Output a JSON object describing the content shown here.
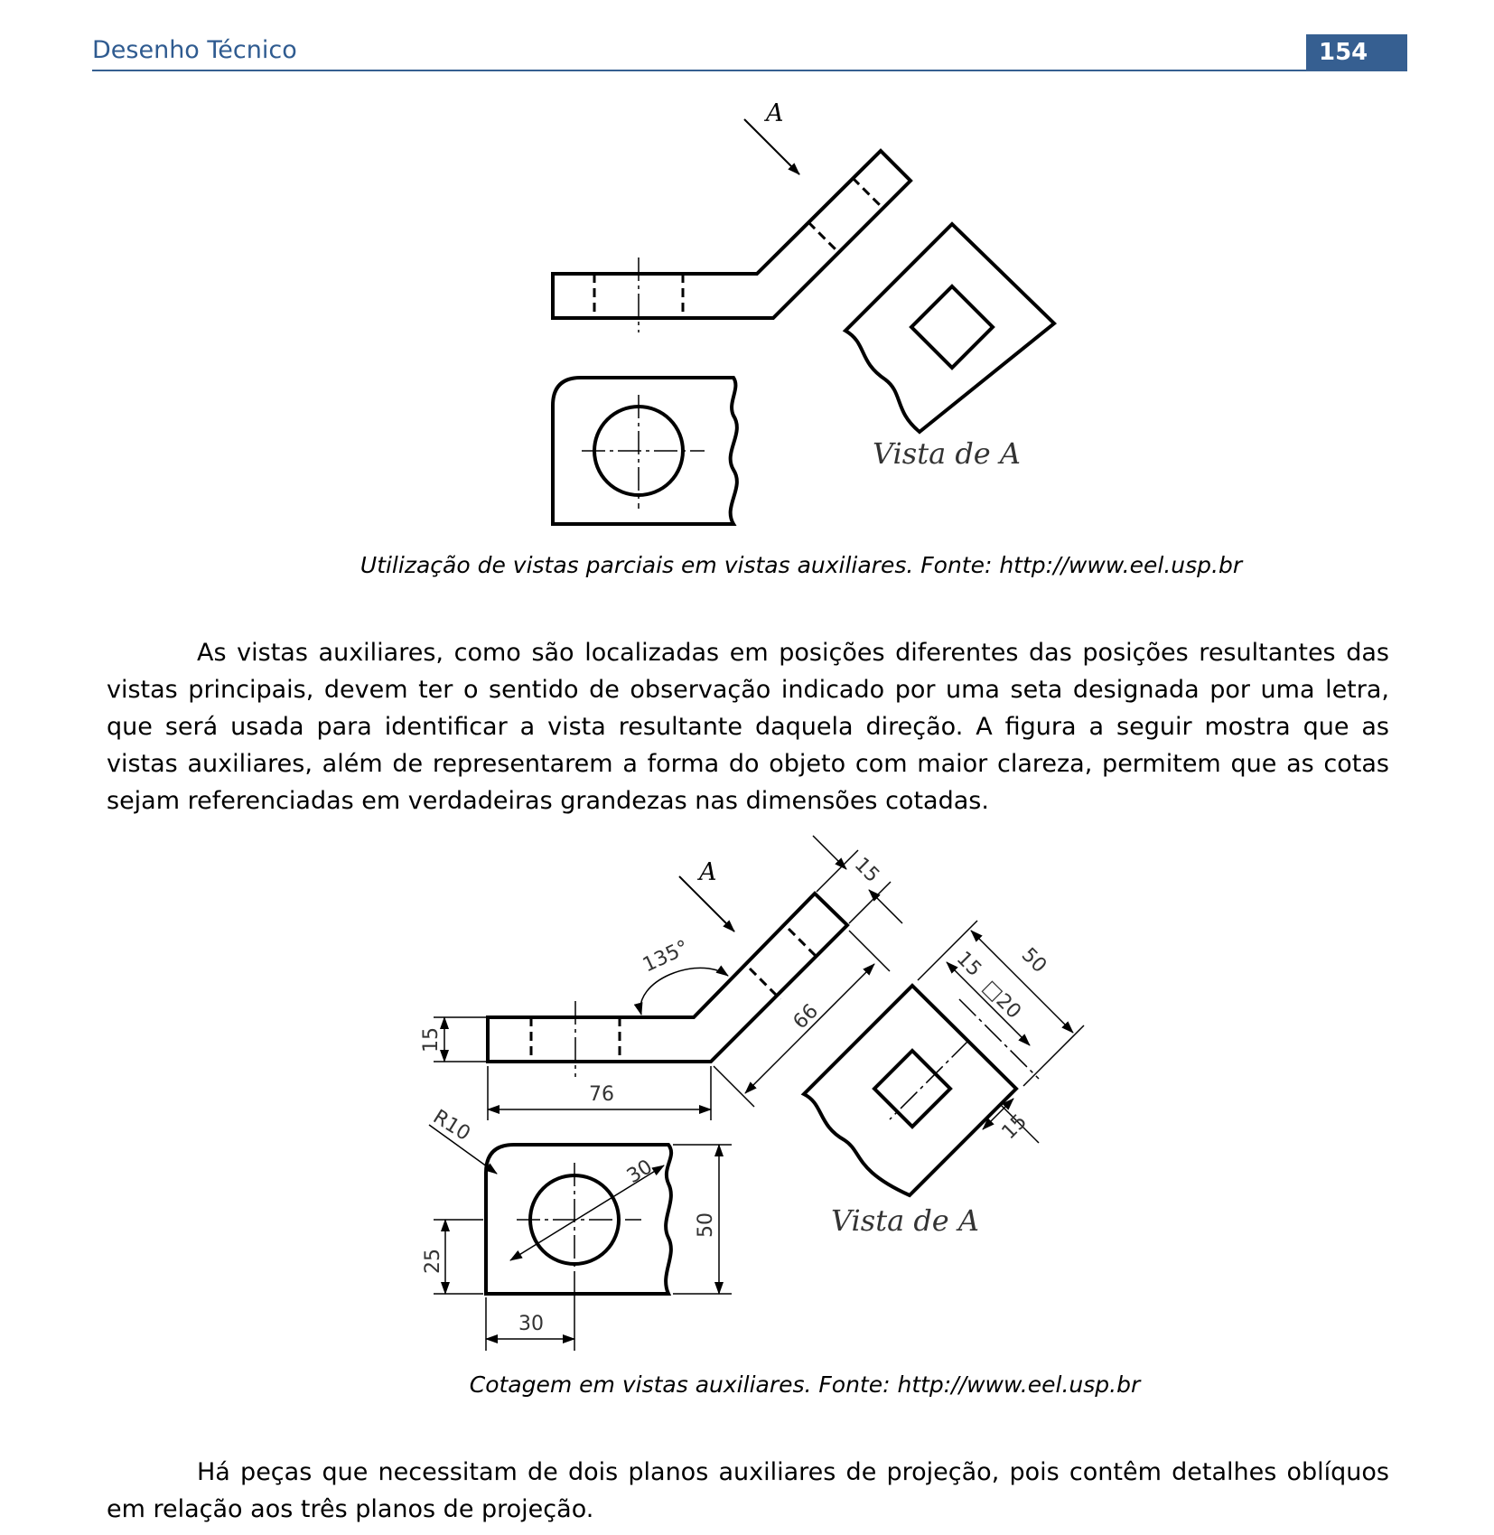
{
  "header": {
    "title": "Desenho Técnico",
    "page_number": "154"
  },
  "figure1": {
    "view_letter": "A",
    "view_label": "Vista de A",
    "caption": "Utilização de vistas parciais em vistas auxiliares. Fonte: http://www.eel.usp.br"
  },
  "paragraph1": "As vistas auxiliares, como são localizadas em posições diferentes das posições resultantes das vistas principais, devem ter o sentido de observação indicado por uma seta designada por uma letra, que será usada para identificar a vista resultante daquela direção. A figura a seguir mostra que as vistas auxiliares, além de representarem a forma do objeto com maior clareza, permitem que as cotas sejam referenciadas em verdadeiras grandezas nas dimensões cotadas.",
  "figure2": {
    "view_letter": "A",
    "view_label": "Vista de A",
    "dims": {
      "thickness_top": "15",
      "thickness_left": "15",
      "angle": "135°",
      "length_inclined": "66",
      "length_horizontal": "76",
      "radius": "R10",
      "hole_diameter": "30",
      "height": "50",
      "hole_center_y": "25",
      "hole_center_x": "30",
      "aux_offset": "15",
      "aux_square": "□20",
      "aux_width": "50",
      "aux_edge": "15"
    },
    "caption": "Cotagem em vistas auxiliares. Fonte: http://www.eel.usp.br"
  },
  "paragraph2": "Há peças que necessitam de dois planos auxiliares de projeção, pois contêm detalhes oblíquos em relação aos três planos de projeção."
}
